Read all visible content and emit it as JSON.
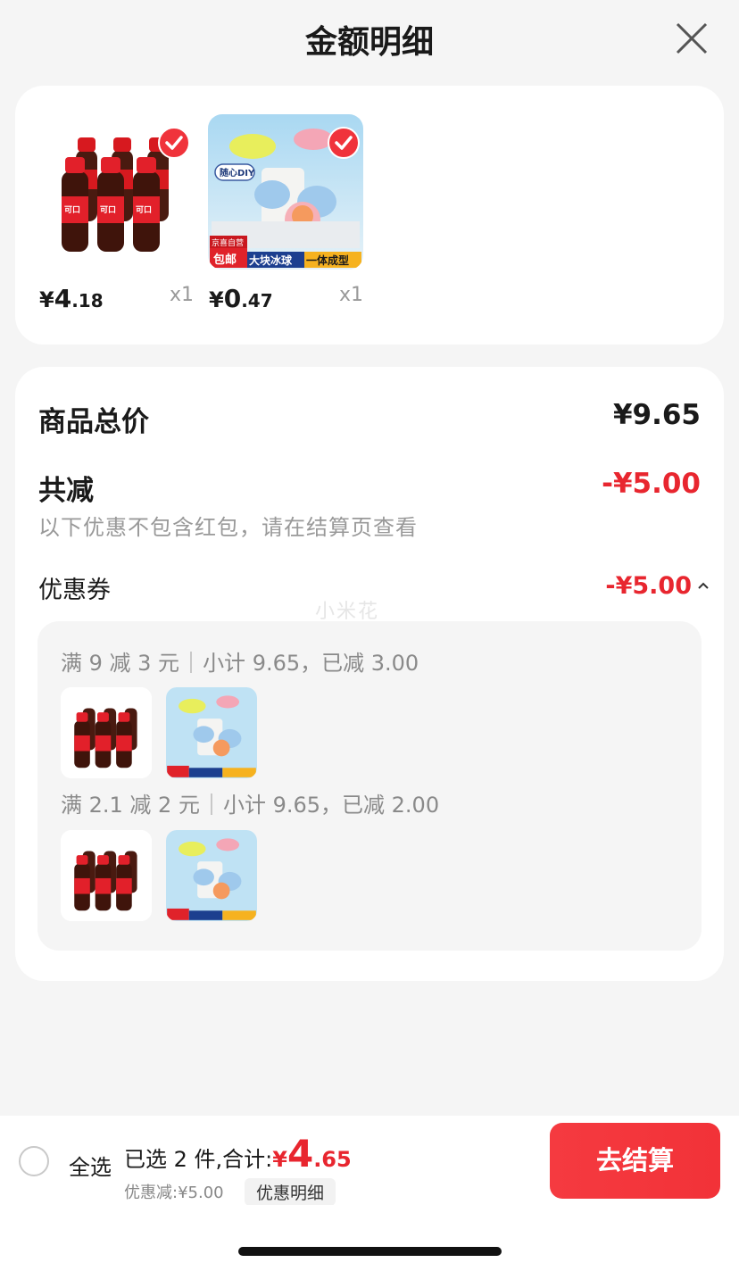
{
  "header": {
    "title": "金额明细"
  },
  "products": [
    {
      "name": "coca-cola-6pack",
      "price_yen": "¥",
      "price_int": "4",
      "price_dec": ".18",
      "qty": "x1",
      "checked": true
    },
    {
      "name": "ice-ball-mold",
      "price_yen": "¥",
      "price_int": "0",
      "price_dec": ".47",
      "qty": "x1",
      "checked": true,
      "badges": {
        "diy": "随心DIY",
        "jd": "京喜自营",
        "free_ship": "包邮",
        "big_ice": "大块冰球",
        "one_piece": "一体成型"
      }
    }
  ],
  "summary": {
    "total_label": "商品总价",
    "total_value": "¥9.65",
    "reduce_label": "共减",
    "reduce_value": "-¥5.00",
    "note": "以下优惠不包含红包，请在结算页查看",
    "coupon_label": "优惠券",
    "coupon_value": "-¥5.00",
    "watermark": "小米花"
  },
  "coupons": [
    {
      "rule": "满 9 减 3 元",
      "detail": "小计 9.65，已减 3.00"
    },
    {
      "rule": "满 2.1 减 2 元",
      "detail": "小计 9.65，已减 2.00"
    }
  ],
  "bottom": {
    "select_all": "全选",
    "selected_prefix": "已选 2 件,合计:",
    "total_yen": "¥",
    "total_int": "4",
    "total_dec": ".65",
    "discount": "优惠减:¥5.00",
    "detail_chip": "优惠明细",
    "checkout": "去结算"
  },
  "colors": {
    "accent": "#e8262f",
    "button": "#f23238"
  }
}
